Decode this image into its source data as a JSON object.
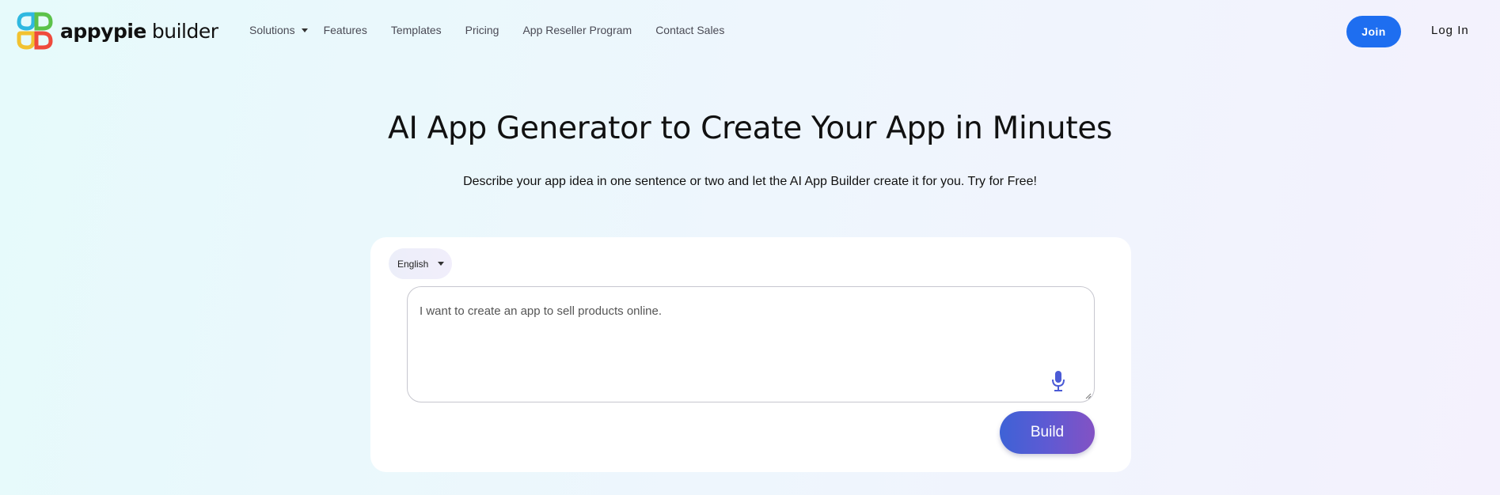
{
  "header": {
    "logo": {
      "brand": "appypie",
      "sub": "builder"
    },
    "nav": [
      {
        "label": "Solutions",
        "has_dropdown": true
      },
      {
        "label": "Features"
      },
      {
        "label": "Templates"
      },
      {
        "label": "Pricing"
      },
      {
        "label": "App Reseller Program"
      },
      {
        "label": "Contact Sales"
      }
    ],
    "join_label": "Join",
    "login_label": "Log In"
  },
  "hero": {
    "title": "AI App Generator to Create Your App in Minutes",
    "subtitle": "Describe your app idea in one sentence or two and let the AI App Builder create it for you. Try for Free!"
  },
  "builder": {
    "language": "English",
    "prompt_value": "I want to create an app to sell products online.",
    "mic_icon": "microphone-icon",
    "build_label": "Build"
  },
  "colors": {
    "accent": "#1e6ef0",
    "build_gradient_start": "#3e62d6",
    "build_gradient_end": "#8352c4",
    "mic": "#4b5bd6"
  }
}
